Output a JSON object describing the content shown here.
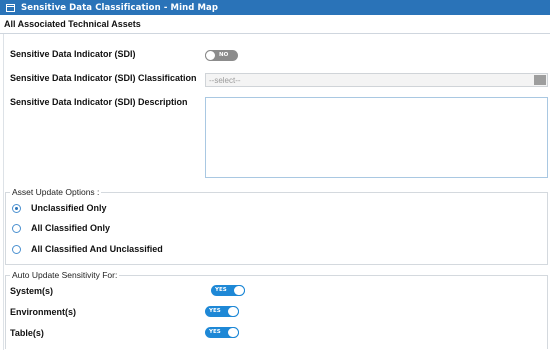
{
  "window": {
    "icon": "window-icon",
    "title": "Sensitive Data Classification - Mind Map"
  },
  "subheader": {
    "title": "All Associated Technical Assets"
  },
  "sdi": {
    "indicator_label": "Sensitive Data Indicator (SDI)",
    "indicator_toggle": "NO",
    "indicator_on": false,
    "classification_label": "Sensitive Data Indicator (SDI) Classification",
    "classification_placeholder": "--select--",
    "description_label": "Sensitive Data Indicator (SDI) Description",
    "description_value": ""
  },
  "asset_update": {
    "legend": "Asset Update Options :",
    "options": [
      {
        "label": "Unclassified Only",
        "checked": true
      },
      {
        "label": "All Classified Only",
        "checked": false
      },
      {
        "label": "All Classified And Unclassified",
        "checked": false
      }
    ]
  },
  "auto_update": {
    "legend": "Auto Update Sensitivity For:",
    "items": [
      {
        "label": "System(s)",
        "toggle": "YES",
        "on": true
      },
      {
        "label": "Environment(s)",
        "toggle": "YES",
        "on": true
      },
      {
        "label": "Table(s)",
        "toggle": "YES",
        "on": true
      }
    ]
  },
  "colors": {
    "titlebar": "#2a73b8",
    "toggle_on": "#1e88d6",
    "toggle_off": "#8c8c8c"
  }
}
